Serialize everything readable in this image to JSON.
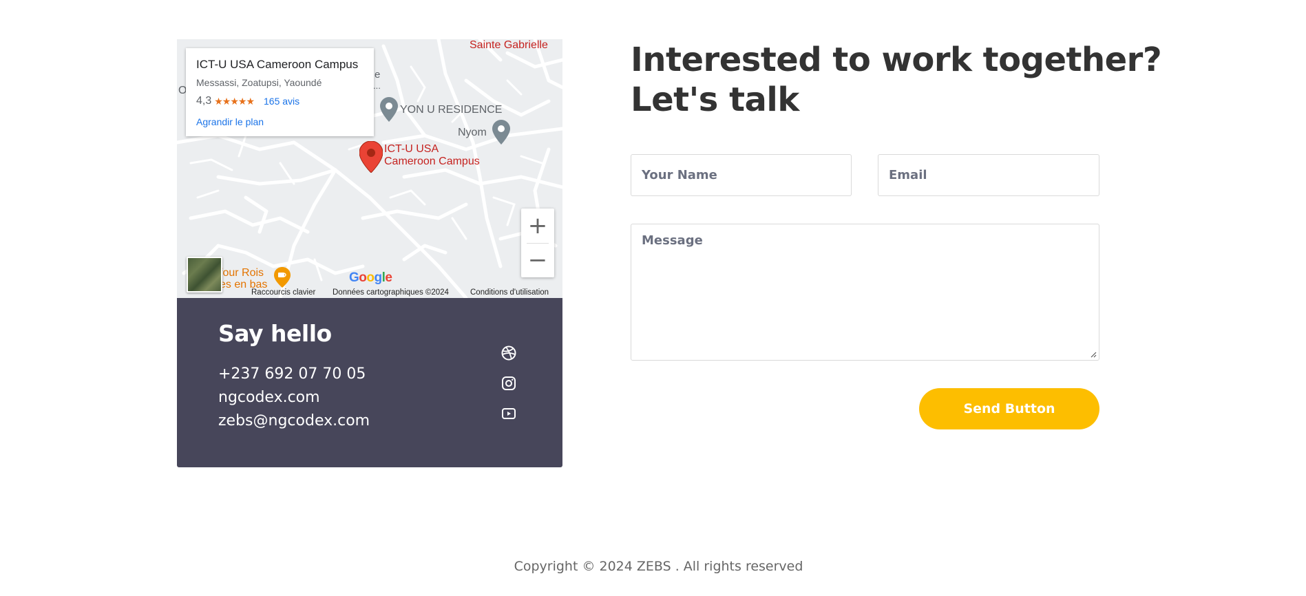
{
  "map": {
    "card_title": "ICT-U USA Cameroon Campus",
    "card_address": "Messassi, Zoatupsi, Yaoundé",
    "rating": "4,3",
    "stars": "★★★★★",
    "reviews": "165 avis",
    "enlarge_link": "Agrandir le plan",
    "poi_sainte": "Sainte Gabrielle",
    "poi_residence": "YON U RESIDENCE",
    "poi_nyom": "Nyom",
    "poi_campus_line1": "ICT-U USA",
    "poi_campus_line2": "Cameroon Campus",
    "poi_carrefour_line1": "four Rois",
    "poi_carrefour_line2": "es en bas",
    "poi_edge_e": "e",
    "poi_edge_dots": "...",
    "poi_edge_o": "O",
    "zoom_in": "+",
    "zoom_out": "−",
    "google": "Google",
    "footer_shortcuts": "Raccourcis clavier",
    "footer_data": "Données cartographiques ©2024",
    "footer_terms": "Conditions d'utilisation"
  },
  "contact": {
    "title": "Say hello",
    "phone": "+237 692 07 70 05",
    "website": "ngcodex.com",
    "email": "zebs@ngcodex.com",
    "social_icons": [
      "dribbble-icon",
      "instagram-icon",
      "youtube-icon"
    ]
  },
  "form": {
    "heading_line1": "Interested to work together?",
    "heading_line2": "Let's talk",
    "name_placeholder": "Your Name",
    "email_placeholder": "Email",
    "message_placeholder": "Message",
    "send_label": "Send Button"
  },
  "footer": {
    "copyright": "Copyright © 2024 ZEBS . All rights reserved"
  },
  "colors": {
    "panel": "#47465a",
    "accent": "#fdbe00",
    "heading": "#333333"
  }
}
